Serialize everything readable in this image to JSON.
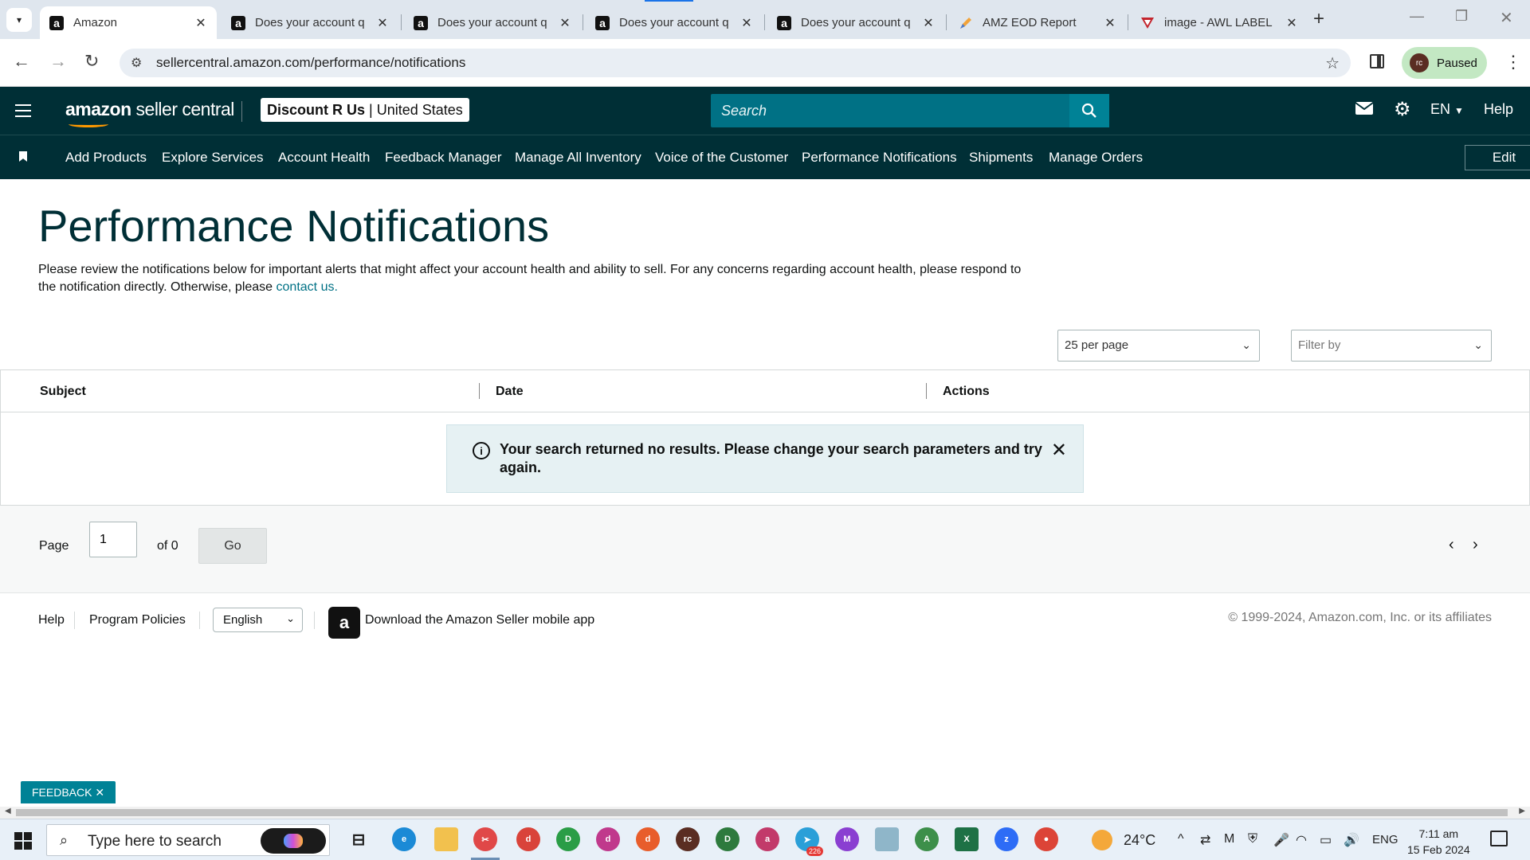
{
  "browser": {
    "tabs": [
      {
        "label": "Amazon",
        "active": true
      },
      {
        "label": "Does your account q"
      },
      {
        "label": "Does your account q"
      },
      {
        "label": "Does your account q"
      },
      {
        "label": "Does your account q"
      },
      {
        "label": "AMZ EOD Report"
      },
      {
        "label": "image - AWL LABEL"
      }
    ],
    "url": "sellercentral.amazon.com/performance/notifications",
    "profile_initials": "rc",
    "profile_status": "Paused"
  },
  "header": {
    "logo_text": "amazon",
    "logo_suffix": "seller central",
    "store_name": "Discount R Us",
    "store_region": "United States",
    "search_placeholder": "Search",
    "language": "EN",
    "help": "Help"
  },
  "subnav": {
    "links": [
      "Add Products",
      "Explore Services",
      "Account Health",
      "Feedback Manager",
      "Manage All Inventory",
      "Voice of the Customer",
      "Performance Notifications",
      "Shipments",
      "Manage Orders"
    ],
    "edit_label": "Edit"
  },
  "main": {
    "title": "Performance Notifications",
    "intro_text": "Please review the notifications below for important alerts that might affect your account health and ability to sell. For any concerns regarding account health, please respond to the notification directly. Otherwise, please",
    "intro_link": "contact us.",
    "per_page": "25 per page",
    "filter_placeholder": "Filter by",
    "columns": [
      "Subject",
      "Date",
      "Actions"
    ],
    "alert_text": "Your search returned no results. Please change your search parameters and try again."
  },
  "pagination": {
    "page_label": "Page",
    "page_value": "1",
    "of_label": "of 0",
    "go_label": "Go"
  },
  "footer": {
    "help": "Help",
    "program_policies": "Program Policies",
    "language": "English",
    "app_text": "Download the Amazon Seller mobile app",
    "copyright": "© 1999-2024, Amazon.com, Inc. or its affiliates"
  },
  "feedback_label": "FEEDBACK ✕",
  "taskbar": {
    "search_placeholder": "Type here to search",
    "temperature": "24°C",
    "language": "ENG",
    "time": "7:11 am",
    "date": "15 Feb 2024",
    "badge": "226"
  }
}
